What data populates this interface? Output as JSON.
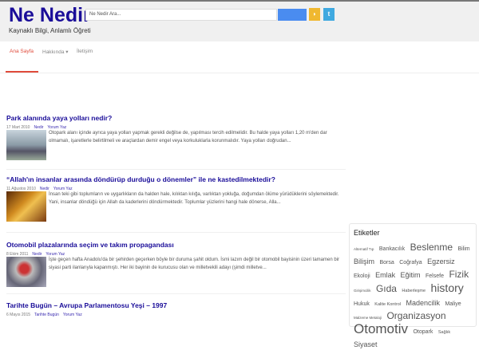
{
  "header": {
    "logo": "Ne Nedir",
    "tagline": "Kaynaklı Bilgi, Anlamlı Öğreti",
    "search_placeholder": "Ne Nedir Ara..."
  },
  "nav": {
    "items": [
      "Ana Sayfa",
      "Hakkında ▾",
      "İletişim"
    ]
  },
  "posts": [
    {
      "title": "Park alanında yaya yolları nedir?",
      "date": "17 Mart 2010",
      "category": "Nedir",
      "comment": "Yorum Yaz",
      "excerpt": "Otopark alanı içinde ayrıca yaya yolları yapmak gerekli değilse de, yapılması tercih edilmelidir. Bu halde yaya yolları 1,20 m'den dar olmamalı, işaretlerle belirtilmeli ve araçlardan demir engel veya korkuluklarla korunmalıdır. Yaya yolları doğrudan..."
    },
    {
      "title": "“Allah'ın insanlar arasında döndürüp durduğu o dönemler” ile ne kastedilmektedir?",
      "date": "11 Ağustos 2010",
      "category": "Nedir",
      "comment": "Yorum Yaz",
      "excerpt": "İnsan teki gibi toplumların ve uygarlıkların da halden hale, kılıktan kılığa, varlıktan yokluğa, doğumdan ölüme yürüdüklerini söylemektedir. Yani, insanlar döndüğü için Allah da kaderlerini döndürmektedir. Toplumlar yüzlerini hangi hale dönerse, Alla..."
    },
    {
      "title": "Otomobil plazalarında seçim ve takım propagandası",
      "date": "8 Ekim 2011",
      "category": "Nedir",
      "comment": "Yorum Yaz",
      "excerpt": "İşte geçen hafta Anadolu'da bir şehirden geçerken böyle bir duruma şahit oldum. İsmi lazım değil bir otomobil bayisinin üzeri tamamen bir siyasi parti ilanlarıyla kapanmıştı. Her iki bayinin de kurucusu olan ve milletvekili adayı (şimdi milletve..."
    },
    {
      "title": "Tarihte Bugün – Avrupa Parlamentosu Yeşi – 1997",
      "date": "6 Mayıs 2015",
      "category": "Tarihte Bugün",
      "comment": "Yorum Yaz",
      "excerpt": ""
    }
  ],
  "sidebar": {
    "title": "Etiketler",
    "tags": [
      {
        "t": "Alternatif Tıp",
        "s": 1
      },
      {
        "t": "Bankacılık",
        "s": 2
      },
      {
        "t": "Beslenme",
        "s": 4
      },
      {
        "t": "Bilim",
        "s": 2
      },
      {
        "t": "Bilişim",
        "s": 3
      },
      {
        "t": "Borsa",
        "s": 2
      },
      {
        "t": "Coğrafya",
        "s": 2
      },
      {
        "t": "Egzersiz",
        "s": 3
      },
      {
        "t": "Ekoloji",
        "s": 2
      },
      {
        "t": "Emlak",
        "s": 3
      },
      {
        "t": "Eğitim",
        "s": 3
      },
      {
        "t": "Felsefe",
        "s": 2
      },
      {
        "t": "Fizik",
        "s": 4
      },
      {
        "t": "Girişimcilik",
        "s": 1
      },
      {
        "t": "Gıda",
        "s": 4
      },
      {
        "t": "Haberleşme",
        "s": 1.5
      },
      {
        "t": "history",
        "s": 5
      },
      {
        "t": "Hukuk",
        "s": 2
      },
      {
        "t": "Kalite Kontrol",
        "s": 1.5
      },
      {
        "t": "Madencilik",
        "s": 3
      },
      {
        "t": "Maliye",
        "s": 2
      },
      {
        "t": "Malzeme Metaloji",
        "s": 1
      },
      {
        "t": "Organizasyon",
        "s": 4
      },
      {
        "t": "Otomotiv",
        "s": 6
      },
      {
        "t": "Otopark",
        "s": 2
      },
      {
        "t": "Sağlık",
        "s": 1.5
      },
      {
        "t": "Siyaset",
        "s": 3
      }
    ]
  },
  "colors": {
    "accent": "#e04a3a",
    "link": "#1a0d99"
  }
}
